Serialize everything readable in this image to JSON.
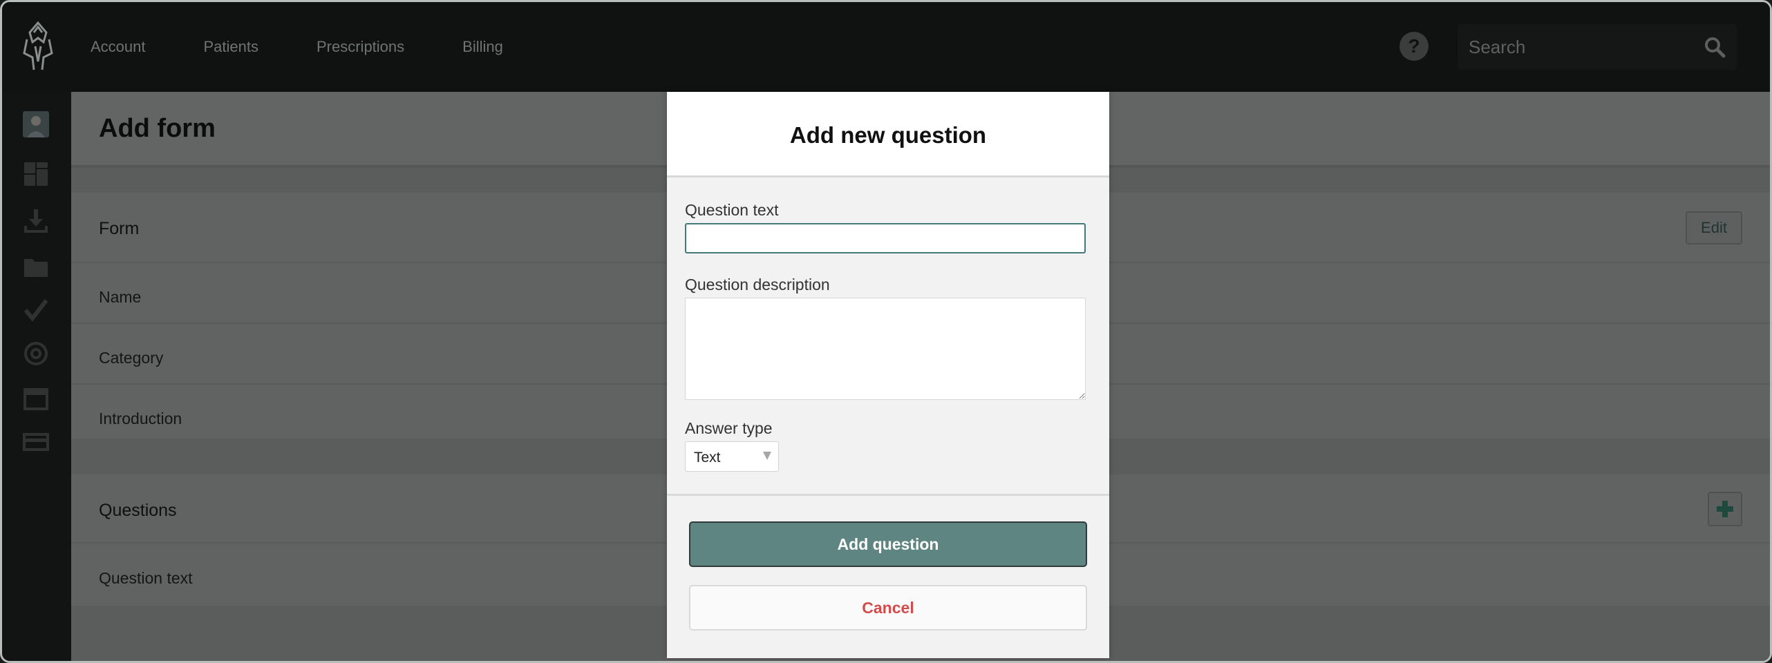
{
  "nav": {
    "items": [
      {
        "label": "Account"
      },
      {
        "label": "Patients"
      },
      {
        "label": "Prescriptions"
      },
      {
        "label": "Billing"
      }
    ],
    "help": "?",
    "search_placeholder": "Search"
  },
  "sidebar": {
    "icons": [
      "avatar-icon",
      "dashboard-icon",
      "download-icon",
      "folder-icon",
      "checkmark-icon",
      "at-icon",
      "calendar-icon",
      "card-icon"
    ]
  },
  "page": {
    "title": "Add form",
    "form_section": {
      "header": "Form",
      "edit_label": "Edit",
      "rows": [
        "Name",
        "Category",
        "Introduction"
      ]
    },
    "questions_section": {
      "header": "Questions",
      "rows": [
        "Question text"
      ]
    }
  },
  "modal": {
    "title": "Add new question",
    "question_text_label": "Question text",
    "question_text_value": "",
    "question_description_label": "Question description",
    "question_description_value": "",
    "answer_type_label": "Answer type",
    "answer_type_value": "Text",
    "add_label": "Add question",
    "cancel_label": "Cancel"
  },
  "colors": {
    "accent": "#5e8582",
    "danger": "#d44b4b",
    "topbar": "#101211"
  }
}
